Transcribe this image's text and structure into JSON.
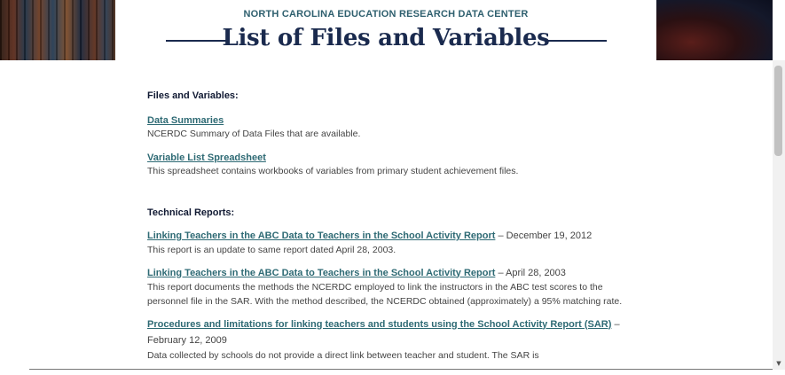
{
  "header": {
    "org_name": "NORTH CAROLINA EDUCATION RESEARCH DATA CENTER",
    "title": "List of Files and Variables"
  },
  "files_section": {
    "heading": "Files and Variables:",
    "items": [
      {
        "link": "Data Summaries",
        "description": "NCERDC Summary of Data Files that are available."
      },
      {
        "link": "Variable List Spreadsheet",
        "description": "This spreadsheet contains workbooks of variables from primary student achievement files."
      }
    ]
  },
  "reports_section": {
    "heading": "Technical Reports:",
    "items": [
      {
        "link": "Linking Teachers in the ABC Data to Teachers in the School Activity Report",
        "date": " – December 19, 2012",
        "description": "This report is an update to same report dated April 28, 2003."
      },
      {
        "link": "Linking Teachers in the ABC Data to Teachers in the School Activity Report",
        "date": " – April 28, 2003",
        "description": "This report documents the methods the NCERDC employed to link the instructors in the ABC test scores to the personnel file in the SAR.  With the method described, the NCERDC obtained (approximately) a 95% matching rate."
      },
      {
        "link": "Procedures and limitations for linking teachers and students using the School Activity Report (SAR)",
        "date": " – February 12, 2009",
        "description": "Data collected by schools do not provide a direct link between teacher and student. The SAR is"
      }
    ]
  },
  "colors": {
    "title_navy": "#1a2a4e",
    "org_teal": "#2e5f6e",
    "link_teal": "#2e6a74"
  }
}
